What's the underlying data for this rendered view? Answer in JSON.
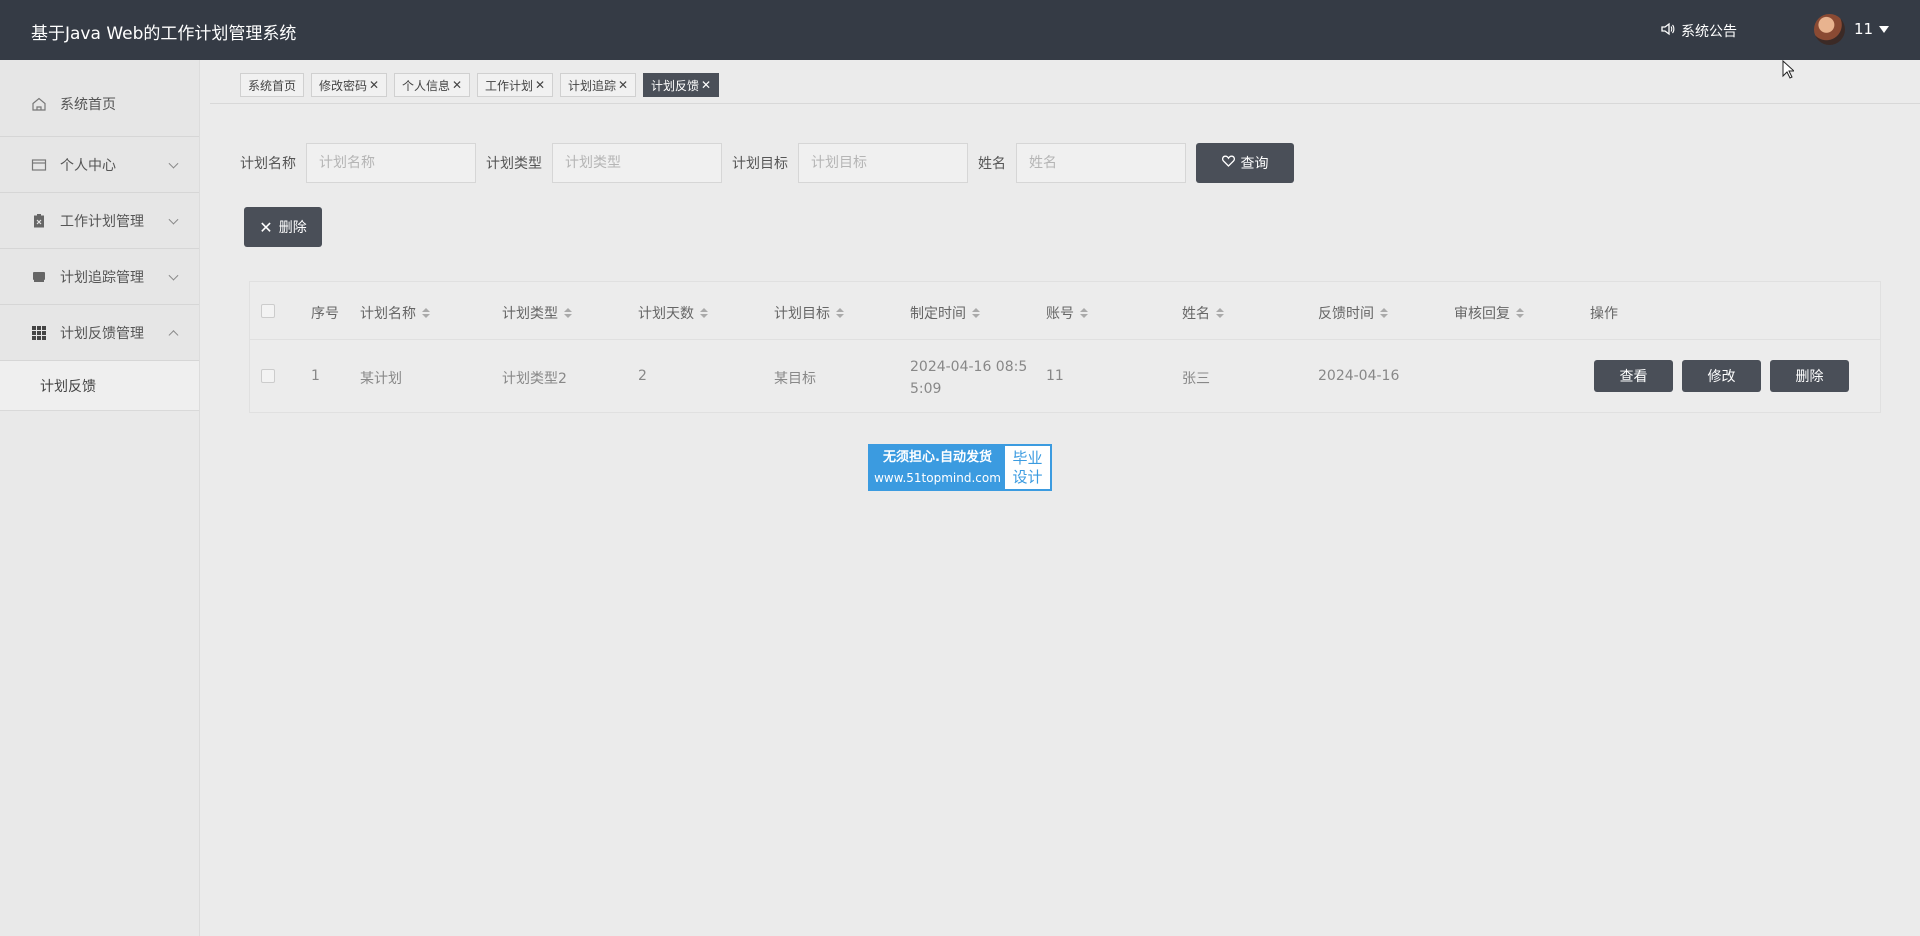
{
  "header": {
    "app_title": "基于Java Web的工作计划管理系统",
    "notice_label": "系统公告",
    "username": "11"
  },
  "sidebar": {
    "items": [
      {
        "label": "系统首页",
        "icon": "home-icon"
      },
      {
        "label": "个人中心",
        "icon": "card-icon"
      },
      {
        "label": "工作计划管理",
        "icon": "clipboard-icon"
      },
      {
        "label": "计划追踪管理",
        "icon": "tray-icon"
      },
      {
        "label": "计划反馈管理",
        "icon": "grid-icon"
      }
    ],
    "sub_item": "计划反馈"
  },
  "tabs": [
    {
      "label": "系统首页",
      "closable": false
    },
    {
      "label": "修改密码",
      "closable": true
    },
    {
      "label": "个人信息",
      "closable": true
    },
    {
      "label": "工作计划",
      "closable": true
    },
    {
      "label": "计划追踪",
      "closable": true
    },
    {
      "label": "计划反馈",
      "closable": true,
      "active": true
    }
  ],
  "search": {
    "plan_name_label": "计划名称",
    "plan_name_placeholder": "计划名称",
    "plan_type_label": "计划类型",
    "plan_type_placeholder": "计划类型",
    "plan_goal_label": "计划目标",
    "plan_goal_placeholder": "计划目标",
    "name_label": "姓名",
    "name_placeholder": "姓名",
    "query_button": "查询"
  },
  "toolbar": {
    "delete_button": "删除"
  },
  "table": {
    "columns": [
      "序号",
      "计划名称",
      "计划类型",
      "计划天数",
      "计划目标",
      "制定时间",
      "账号",
      "姓名",
      "反馈时间",
      "审核回复",
      "操作"
    ],
    "rows": [
      {
        "index": "1",
        "plan_name": "某计划",
        "plan_type": "计划类型2",
        "days": "2",
        "goal": "某目标",
        "created_line1": "2024-04-16 08:5",
        "created_line2": "5:09",
        "account": "11",
        "name": "张三",
        "feedback_time": "2024-04-16",
        "review_reply": "",
        "actions": [
          "查看",
          "修改",
          "删除"
        ]
      }
    ]
  },
  "stamp": {
    "line1": "无须担心.自动发货",
    "line2": "www.51topmind.com",
    "right1": "毕业",
    "right2": "设计"
  },
  "colors": {
    "topbar": "#353b45",
    "button_dark": "#4a4f58",
    "stamp_blue": "#3b9be0"
  }
}
